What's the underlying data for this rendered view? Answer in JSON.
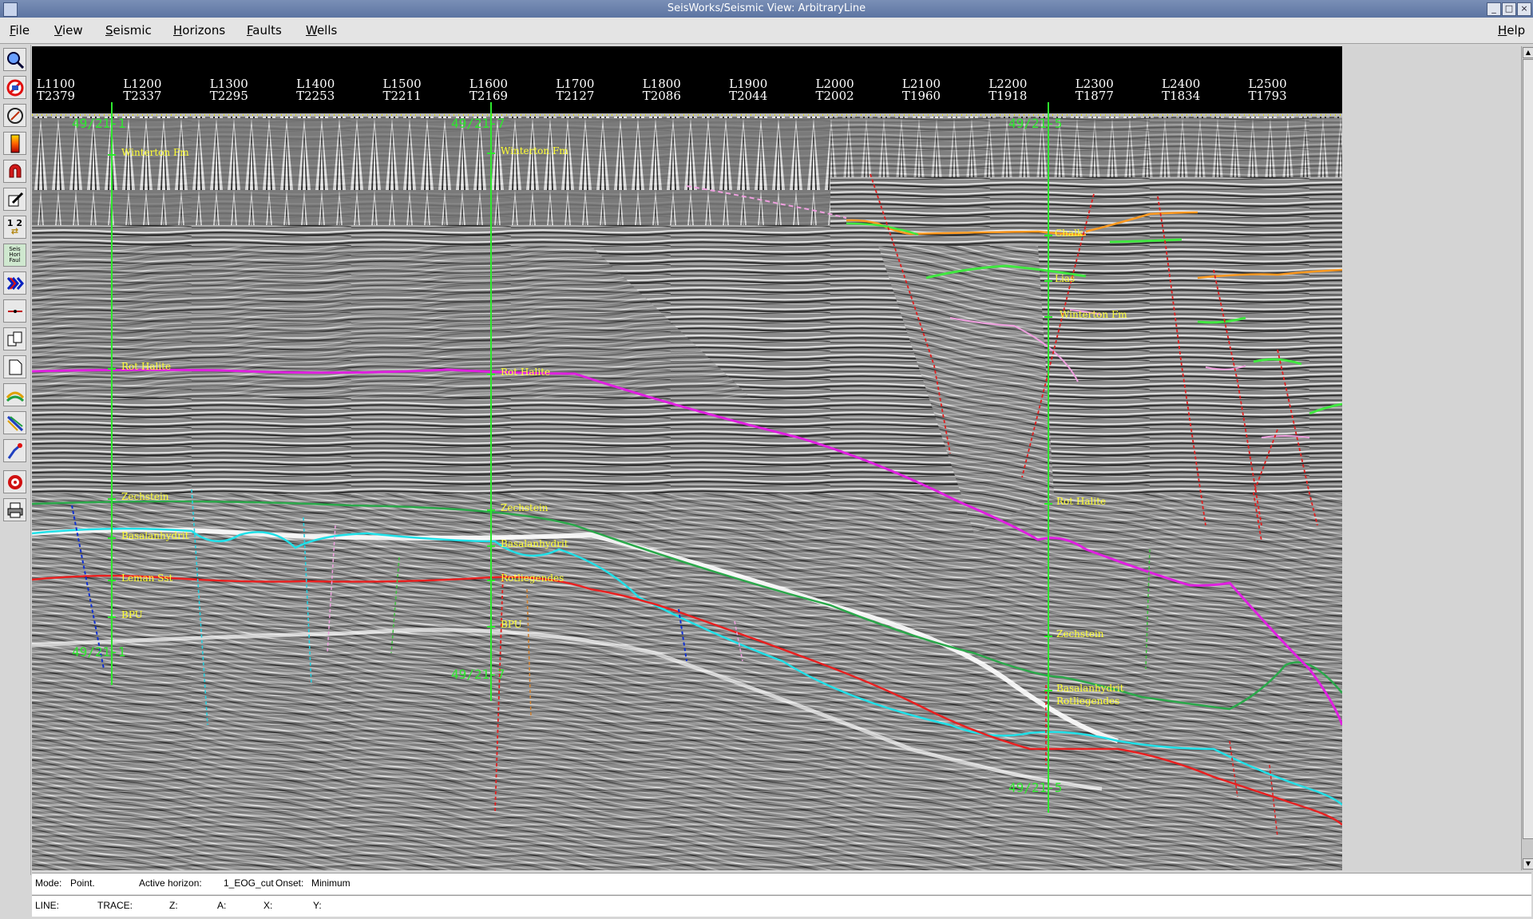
{
  "window": {
    "title": "SeisWorks/Seismic View: ArbitraryLine",
    "controls": [
      "minimize-icon",
      "maximize-icon",
      "close-icon"
    ]
  },
  "menubar": {
    "items": [
      "File",
      "View",
      "Seismic",
      "Horizons",
      "Faults",
      "Wells"
    ],
    "help": "Help"
  },
  "toolbar": {
    "tools": [
      "zoom-icon",
      "no-entry-icon",
      "compass-icon",
      "color-bar-icon",
      "magnet-icon",
      "edit-icon",
      "numbers-swap-icon",
      "seis-hori-faul-icon",
      "wiggle-icon",
      "line-icon",
      "copy-icon",
      "page-icon",
      "horizon-icon",
      "fault-icon",
      "pick-icon",
      "target-icon",
      "print-icon"
    ],
    "numbers_label": "1 2",
    "seis_label": "Seis",
    "hori_label": "Hori",
    "faul_label": "Faul"
  },
  "seismic": {
    "line_labels": [
      "L1100",
      "L1200",
      "L1300",
      "L1400",
      "L1500",
      "L1600",
      "L1700",
      "L1800",
      "L1900",
      "L2000",
      "L2100",
      "L2200",
      "L2300",
      "L2400",
      "L2500"
    ],
    "trace_labels": [
      "T2379",
      "T2337",
      "T2295",
      "T2253",
      "T2211",
      "T2169",
      "T2127",
      "T2086",
      "T2044",
      "T2002",
      "T1960",
      "T1918",
      "T1877",
      "T1834",
      "T1793"
    ],
    "wells": [
      {
        "name": "49/21-1",
        "picks": [
          "Winterton Fm",
          "Rot Halite",
          "Zechstein",
          "Basalanhydrit",
          "Leman Sst",
          "BPU"
        ]
      },
      {
        "name": "49/21-7",
        "picks": [
          "Winterton Fm",
          "Rot Halite",
          "Zechstein",
          "Basalanhydrit",
          "Rotliegendes",
          "BPU"
        ]
      },
      {
        "name": "49/21-5",
        "picks": [
          "Chalk",
          "Lias",
          "Winterton Fm",
          "Rot Halite",
          "Zechstein",
          "Basalanhydrit",
          "Rotliegendes"
        ]
      }
    ],
    "colors": {
      "background": "#888888",
      "well": "#2ee82e",
      "pick_text": "#ffff33",
      "rot_halite": "#e020e0",
      "zechstein": "#2aa84a",
      "basalanhydrit": "#20e0e8",
      "rotliegendes": "#e82020",
      "chalk": "#ff9a20",
      "lias": "#40e840",
      "winterton": "#f0a0e0",
      "fault": "#e02020"
    }
  },
  "status": {
    "mode_label": "Mode:",
    "mode_value": "Point.",
    "active_horizon_label": "Active horizon:",
    "active_horizon_value": "1_EOG_cut",
    "onset_label": "Onset:",
    "onset_value": "Minimum",
    "line_label": "LINE:",
    "trace_label": "TRACE:",
    "z_label": "Z:",
    "a_label": "A:",
    "x_label": "X:",
    "y_label": "Y:"
  }
}
